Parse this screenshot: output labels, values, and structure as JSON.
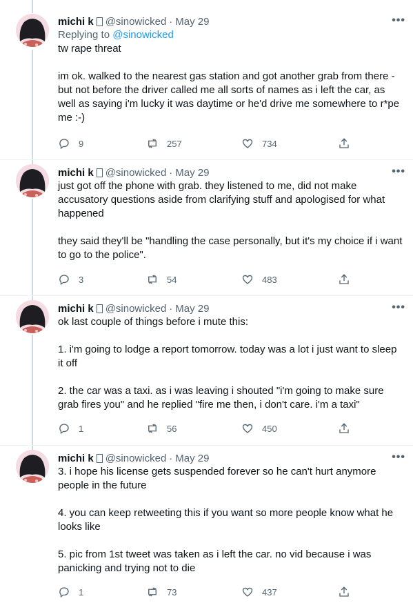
{
  "user": {
    "name": "michi k",
    "badge_icon": "unknown-glyph-icon",
    "handle": "@sinowicked",
    "separator": "·"
  },
  "tweets": [
    {
      "date": "May 29",
      "replying_prefix": "Replying to",
      "replying_handle": "@sinowicked",
      "paragraphs": [
        "tw rape threat",
        "im ok. walked to the nearest gas station and got another grab from there - but not before the driver called me all sorts of names as i left the car, as well as saying i'm lucky it was daytime or he'd drive me somewhere to r*pe me :-)"
      ],
      "replies": "9",
      "retweets": "257",
      "likes": "734"
    },
    {
      "date": "May 29",
      "paragraphs": [
        "just got off the phone with grab. they listened to me, did not make accusatory questions aside from clarifying stuff and apologised for what happened",
        "they said they'll be \"handling the case personally, but it's my choice if i want to go to the police\"."
      ],
      "replies": "3",
      "retweets": "54",
      "likes": "483"
    },
    {
      "date": "May 29",
      "paragraphs": [
        "ok last couple of things before i mute this:",
        "1. i'm going to lodge a report tomorrow. today was a lot i just want to sleep it off",
        "2. the car was a taxi. as i was leaving i shouted \"i'm going to make sure grab fires you\" and he replied \"fire me then, i don't care. i'm a taxi\""
      ],
      "replies": "1",
      "retweets": "56",
      "likes": "450"
    },
    {
      "date": "May 29",
      "paragraphs": [
        "3. i hope his license gets suspended forever so he can't hurt anymore people in the future",
        "4. you can keep retweeting this if you want so more people know what he looks like",
        "5. pic from 1st tweet was taken as i left the car. no vid because i was panicking and trying not to die"
      ],
      "replies": "1",
      "retweets": "73",
      "likes": "437"
    }
  ],
  "more_label": "•••",
  "colors": {
    "text": "#0f1419",
    "secondary": "#536471",
    "link": "#1d9bf0",
    "connector": "#cfd9de",
    "divider": "#eff3f4"
  }
}
